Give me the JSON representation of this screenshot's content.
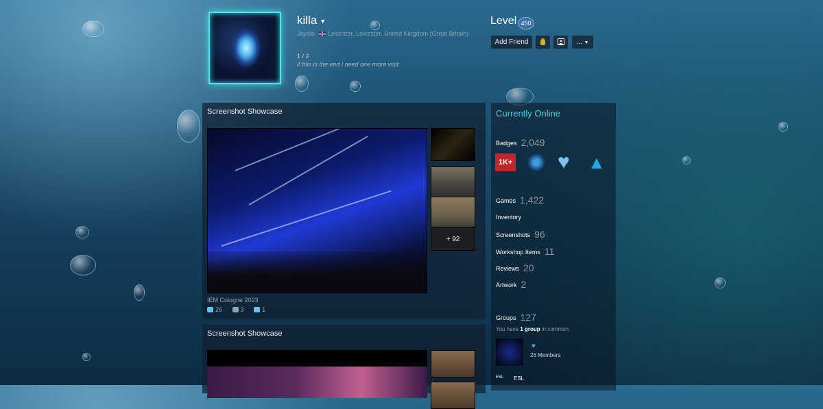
{
  "profile": {
    "persona_name": "killa",
    "real_name": "Jaydip",
    "location": "Leicester, Leicester, United Kingdom (Great Britain)",
    "counter": "1 / 2",
    "summary": "if this is the end i need one more visit",
    "level_label": "Level",
    "level": "450"
  },
  "buttons": {
    "add_friend": "Add Friend",
    "more": "..."
  },
  "showcase1": {
    "title": "Screenshot Showcase",
    "caption": "IEM Cologne 2023",
    "likes": "26",
    "comments": "3",
    "awards": "1",
    "more_count": "+ 92"
  },
  "showcase2": {
    "title": "Screenshot Showcase"
  },
  "sidebar": {
    "status": "Currently Online",
    "badges_label": "Badges",
    "badges_count": "2,049",
    "badge_1k": "1K+",
    "games_label": "Games",
    "games_count": "1,422",
    "inventory_label": "Inventory",
    "screenshots_label": "Screenshots",
    "screenshots_count": "96",
    "workshop_label": "Workshop Items",
    "workshop_count": "11",
    "reviews_label": "Reviews",
    "reviews_count": "20",
    "artwork_label": "Artwork",
    "artwork_count": "2",
    "groups_label": "Groups",
    "groups_count": "127",
    "common_prefix": "You have",
    "common_bold": "1 group",
    "common_suffix": "in common",
    "group_members": "26 Members",
    "group2_name": "ESL",
    "group2_logo": "ESL"
  },
  "colors": {
    "online": "#57cbde",
    "avatar_frame": "#4fe3e8",
    "badge_1k": "#c0262a"
  }
}
